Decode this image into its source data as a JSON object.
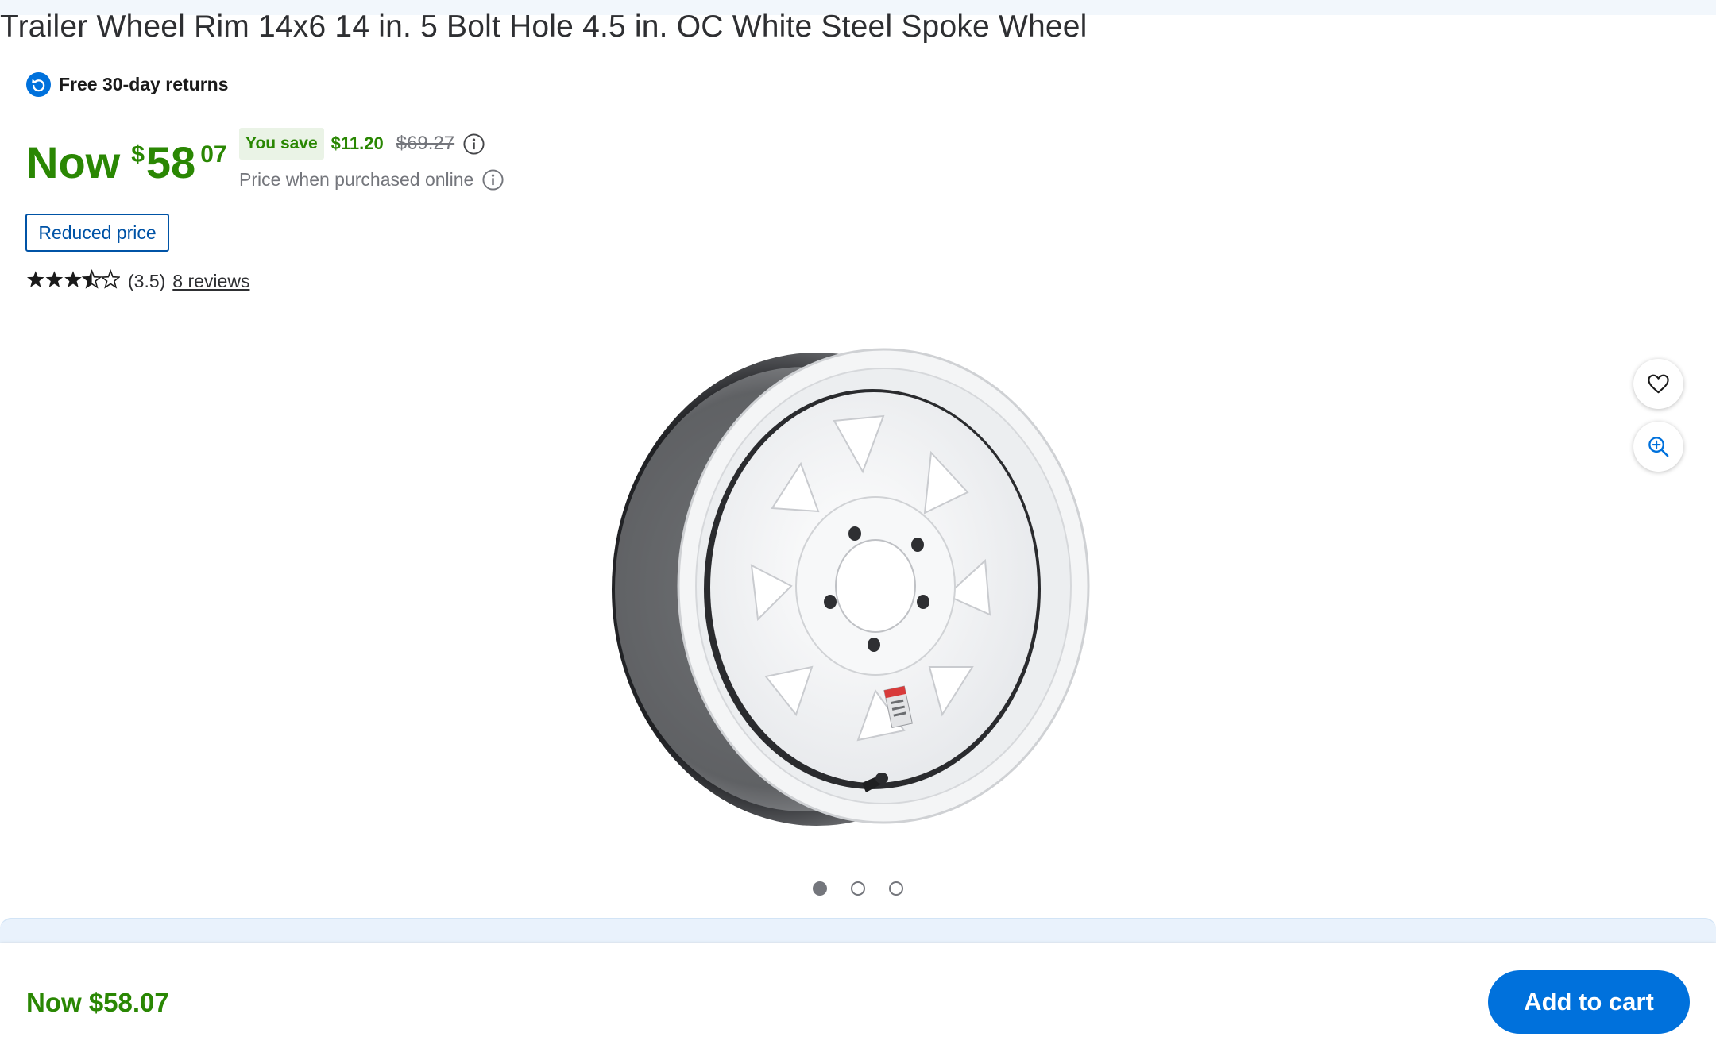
{
  "product": {
    "title": "Trailer Wheel Rim 14x6 14 in. 5 Bolt Hole 4.5 in. OC White Steel Spoke Wheel"
  },
  "returns": {
    "label": "Free 30-day returns",
    "icon": "returns-icon"
  },
  "price": {
    "prefix": "Now",
    "currency": "$",
    "dollars": "58",
    "cents": "07",
    "save_label": "You save",
    "save_amount": "$11.20",
    "was_price": "$69.27",
    "note": "Price when purchased online"
  },
  "badge": {
    "label": "Reduced price"
  },
  "rating": {
    "score": 3.5,
    "max": 5,
    "value_text": "(3.5)",
    "reviews_link": "8 reviews"
  },
  "gallery": {
    "image_count": 3,
    "active_index": 0,
    "actions": [
      "heart-icon",
      "zoom-in-icon"
    ]
  },
  "sticky_bar": {
    "price": "Now $58.07",
    "cta": "Add to cart"
  },
  "colors": {
    "price_green": "#2a8703",
    "link_blue": "#0053a6",
    "cta_blue": "#0071dc",
    "muted_gray": "#74767c"
  }
}
